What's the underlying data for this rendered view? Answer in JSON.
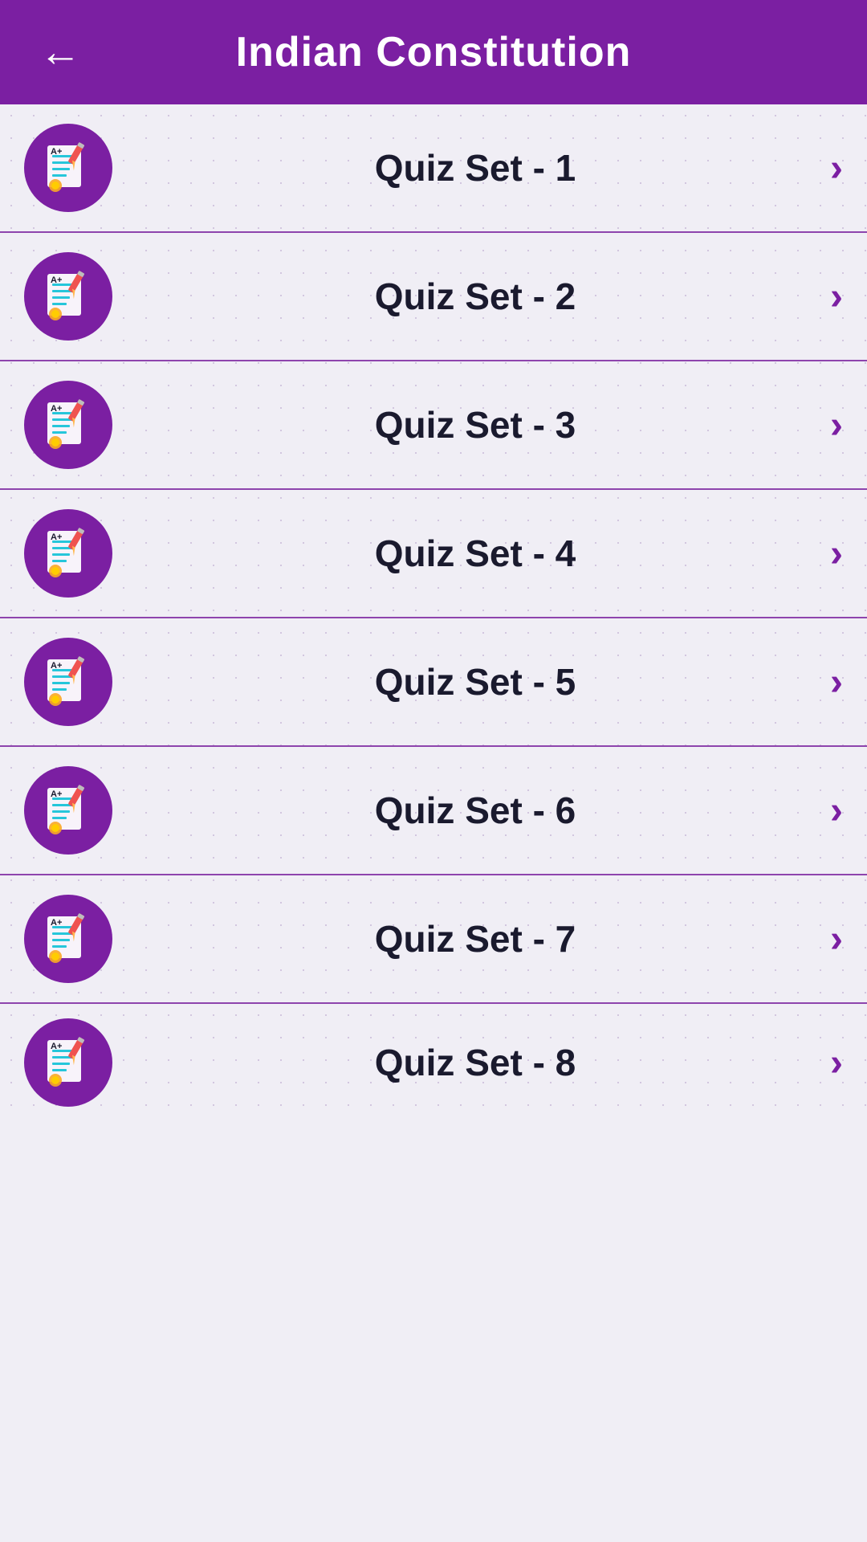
{
  "header": {
    "title": "Indian Constitution",
    "back_label": "←"
  },
  "colors": {
    "header_bg": "#7b1fa2",
    "icon_bg": "#7b1fa2",
    "chevron": "#7b1fa2",
    "text_dark": "#1a1a2e",
    "border": "#8e44ad"
  },
  "quiz_sets": [
    {
      "id": 1,
      "label": "Quiz Set - 1"
    },
    {
      "id": 2,
      "label": "Quiz Set - 2"
    },
    {
      "id": 3,
      "label": "Quiz Set - 3"
    },
    {
      "id": 4,
      "label": "Quiz Set - 4"
    },
    {
      "id": 5,
      "label": "Quiz Set - 5"
    },
    {
      "id": 6,
      "label": "Quiz Set - 6"
    },
    {
      "id": 7,
      "label": "Quiz Set - 7"
    },
    {
      "id": 8,
      "label": "Quiz Set - 8"
    }
  ]
}
